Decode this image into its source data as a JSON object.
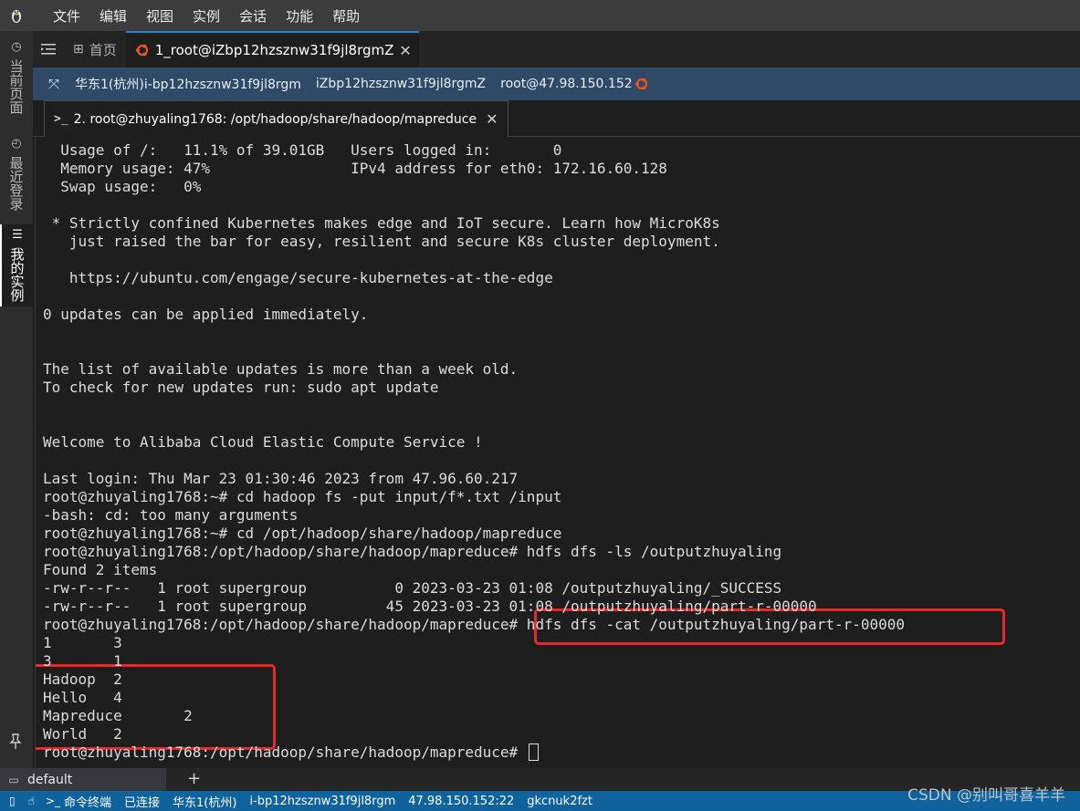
{
  "menu": [
    "文件",
    "编辑",
    "视图",
    "实例",
    "会话",
    "功能",
    "帮助"
  ],
  "leftbar": {
    "tabs": [
      "当前页面",
      "最近登录",
      "我的实例"
    ]
  },
  "tabs": {
    "home_label": "首页",
    "active_label": "1_root@iZbp12hzsznw31f9jl8rgmZ"
  },
  "infobar": {
    "region_instance": "华东1(杭州)i-bp12hzsznw31f9jl8rgm",
    "hostname": "iZbp12hzsznw31f9jl8rgmZ",
    "user_host": "root@47.98.150.152"
  },
  "terminal_tab": {
    "prompt": ">_",
    "label": "2. root@zhuyaling1768: /opt/hadoop/share/hadoop/mapreduce"
  },
  "terminal": {
    "lines": [
      "  Usage of /:   11.1% of 39.01GB   Users logged in:       0",
      "  Memory usage: 47%                IPv4 address for eth0: 172.16.60.128",
      "  Swap usage:   0%",
      "",
      " * Strictly confined Kubernetes makes edge and IoT secure. Learn how MicroK8s",
      "   just raised the bar for easy, resilient and secure K8s cluster deployment.",
      "",
      "   https://ubuntu.com/engage/secure-kubernetes-at-the-edge",
      "",
      "0 updates can be applied immediately.",
      "",
      "",
      "The list of available updates is more than a week old.",
      "To check for new updates run: sudo apt update",
      "",
      "",
      "Welcome to Alibaba Cloud Elastic Compute Service !",
      "",
      "Last login: Thu Mar 23 01:30:46 2023 from 47.96.60.217",
      "root@zhuyaling1768:~# cd hadoop fs -put input/f*.txt /input",
      "-bash: cd: too many arguments",
      "root@zhuyaling1768:~# cd /opt/hadoop/share/hadoop/mapreduce",
      "root@zhuyaling1768:/opt/hadoop/share/hadoop/mapreduce# hdfs dfs -ls /outputzhuyaling",
      "Found 2 items",
      "-rw-r--r--   1 root supergroup          0 2023-03-23 01:08 /outputzhuyaling/_SUCCESS",
      "-rw-r--r--   1 root supergroup         45 2023-03-23 01:08 /outputzhuyaling/part-r-00000",
      "root@zhuyaling1768:/opt/hadoop/share/hadoop/mapreduce# hdfs dfs -cat /outputzhuyaling/part-r-00000",
      "1       3",
      "3       1",
      "Hadoop  2",
      "Hello   4",
      "Mapreduce       2",
      "World   2",
      "root@zhuyaling1768:/opt/hadoop/share/hadoop/mapreduce# "
    ]
  },
  "session_bar": {
    "session_label": "default",
    "add_label": "+"
  },
  "statusbar": {
    "terminal_label": "命令终端",
    "connection": "已连接",
    "region_label": "华东1(杭州)",
    "instance": "i-bp12hzsznw31f9jl8rgm",
    "address": "47.98.150.152:22",
    "session_id": "gkcnuk2fzt"
  },
  "watermark": "CSDN @别叫哥喜羊羊",
  "colors": {
    "menubar": "#3c3c3c",
    "infobar": "#2e4a66",
    "statusbar": "#0e639c",
    "highlight": "#e8292b",
    "ubuntu": "#e95420"
  }
}
